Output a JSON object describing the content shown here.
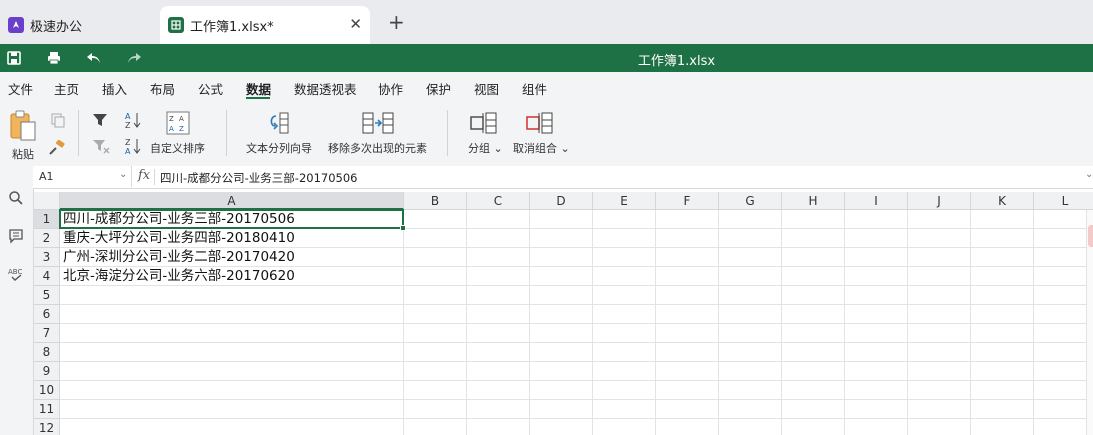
{
  "tabs": [
    {
      "label": "极速办公"
    },
    {
      "label": "工作簿1.xlsx*"
    }
  ],
  "tab_add_label": "+",
  "tab_close_label": "✕",
  "title": {
    "document": "工作簿1.xlsx"
  },
  "menu": [
    {
      "label": "文件"
    },
    {
      "label": "主页"
    },
    {
      "label": "插入"
    },
    {
      "label": "布局"
    },
    {
      "label": "公式"
    },
    {
      "label": "数据"
    },
    {
      "label": "数据透视表"
    },
    {
      "label": "协作"
    },
    {
      "label": "保护"
    },
    {
      "label": "视图"
    },
    {
      "label": "组件"
    }
  ],
  "active_menu": "数据",
  "ribbon": {
    "paste": "粘贴",
    "custom_sort": "自定义排序",
    "text_to_columns": "文本分列向导",
    "remove_duplicates": "移除多次出现的元素",
    "group": "分组",
    "ungroup": "取消组合"
  },
  "formula_bar": {
    "cell_ref": "A1",
    "fx": "fx",
    "content": "四川-成都分公司-业务三部-20170506"
  },
  "columns": [
    "A",
    "B",
    "C",
    "D",
    "E",
    "F",
    "G",
    "H",
    "I",
    "J",
    "K",
    "L"
  ],
  "rows": [
    "1",
    "2",
    "3",
    "4",
    "5",
    "6",
    "7",
    "8",
    "9",
    "10",
    "11",
    "12"
  ],
  "cells": [
    "四川-成都分公司-业务三部-20170506",
    "重庆-大坪分公司-业务四部-20180410",
    "广州-深圳分公司-业务二部-20170420",
    "北京-海淀分公司-业务六部-20170620"
  ],
  "colors": {
    "brand_green": "#1e7145",
    "tab_bg": "#e9ebee",
    "ribbon_bg": "#f3f4f6"
  }
}
